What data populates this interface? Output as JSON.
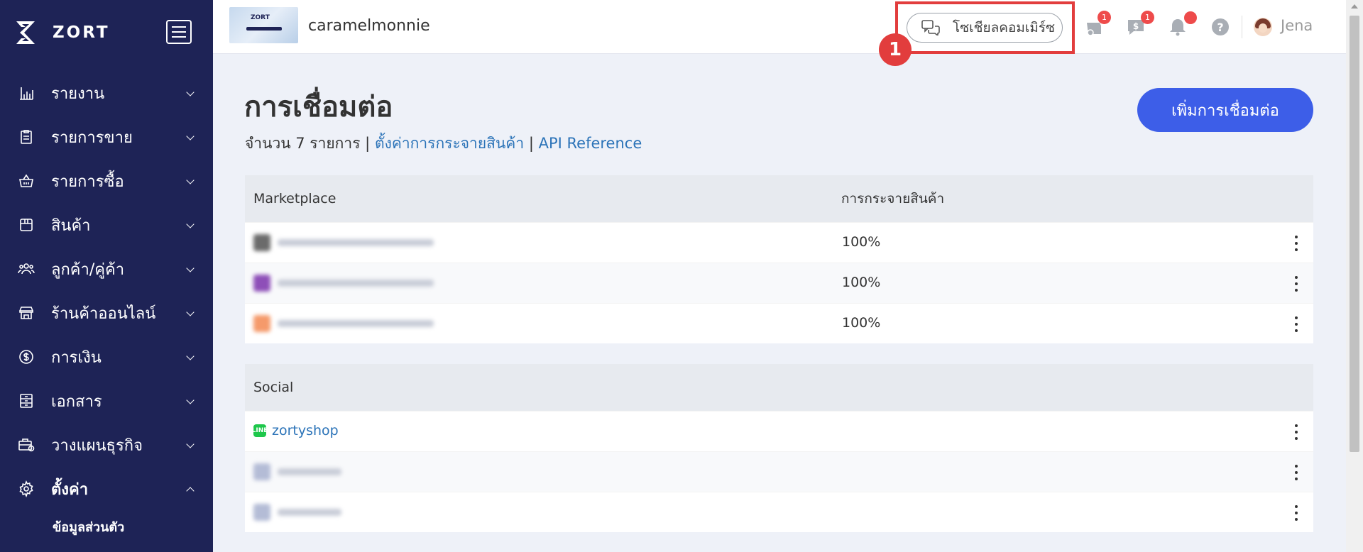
{
  "app": {
    "brand": "ZORT"
  },
  "sidebar": {
    "items": [
      {
        "label": "รายงาน",
        "icon": "bar-chart-icon"
      },
      {
        "label": "รายการขาย",
        "icon": "clipboard-icon"
      },
      {
        "label": "รายการซื้อ",
        "icon": "basket-icon"
      },
      {
        "label": "สินค้า",
        "icon": "box-icon"
      },
      {
        "label": "ลูกค้า/คู่ค้า",
        "icon": "users-icon"
      },
      {
        "label": "ร้านค้าออนไลน์",
        "icon": "store-icon"
      },
      {
        "label": "การเงิน",
        "icon": "dollar-icon"
      },
      {
        "label": "เอกสาร",
        "icon": "document-icon"
      },
      {
        "label": "วางแผนธุรกิจ",
        "icon": "briefcase-icon"
      },
      {
        "label": "ตั้งค่า",
        "icon": "gear-icon"
      }
    ],
    "sub_item": "ข้อมูลส่วนตัว"
  },
  "header": {
    "shop_thumb_text": "ZORT",
    "shop_name": "caramelmonnie",
    "social_button": "โซเชียลคอมเมิร์ซ",
    "step_number": "1",
    "notif_counts": [
      "1",
      "1"
    ],
    "user_name": "Jena"
  },
  "main": {
    "title": "การเชื่อมต่อ",
    "count_text": "จำนวน 7 รายการ",
    "separator": "|",
    "link_distribution": "ตั้งค่าการกระจายสินค้า",
    "link_api": "API Reference",
    "add_button": "เพิ่มการเชื่อมต่อ"
  },
  "marketplace": {
    "header": "Marketplace",
    "col2": "การกระจายสินค้า",
    "rows": [
      {
        "pct": "100%",
        "color": "#6b6b6b"
      },
      {
        "pct": "100%",
        "color": "#8e4fb8"
      },
      {
        "pct": "100%",
        "color": "#f59a6b"
      }
    ]
  },
  "social": {
    "header": "Social",
    "line_icon": "LINE",
    "line_name": "zortyshop"
  },
  "colors": {
    "sidebar": "#1e2356",
    "accent": "#3d5ee8",
    "highlight": "#e23d3d"
  }
}
